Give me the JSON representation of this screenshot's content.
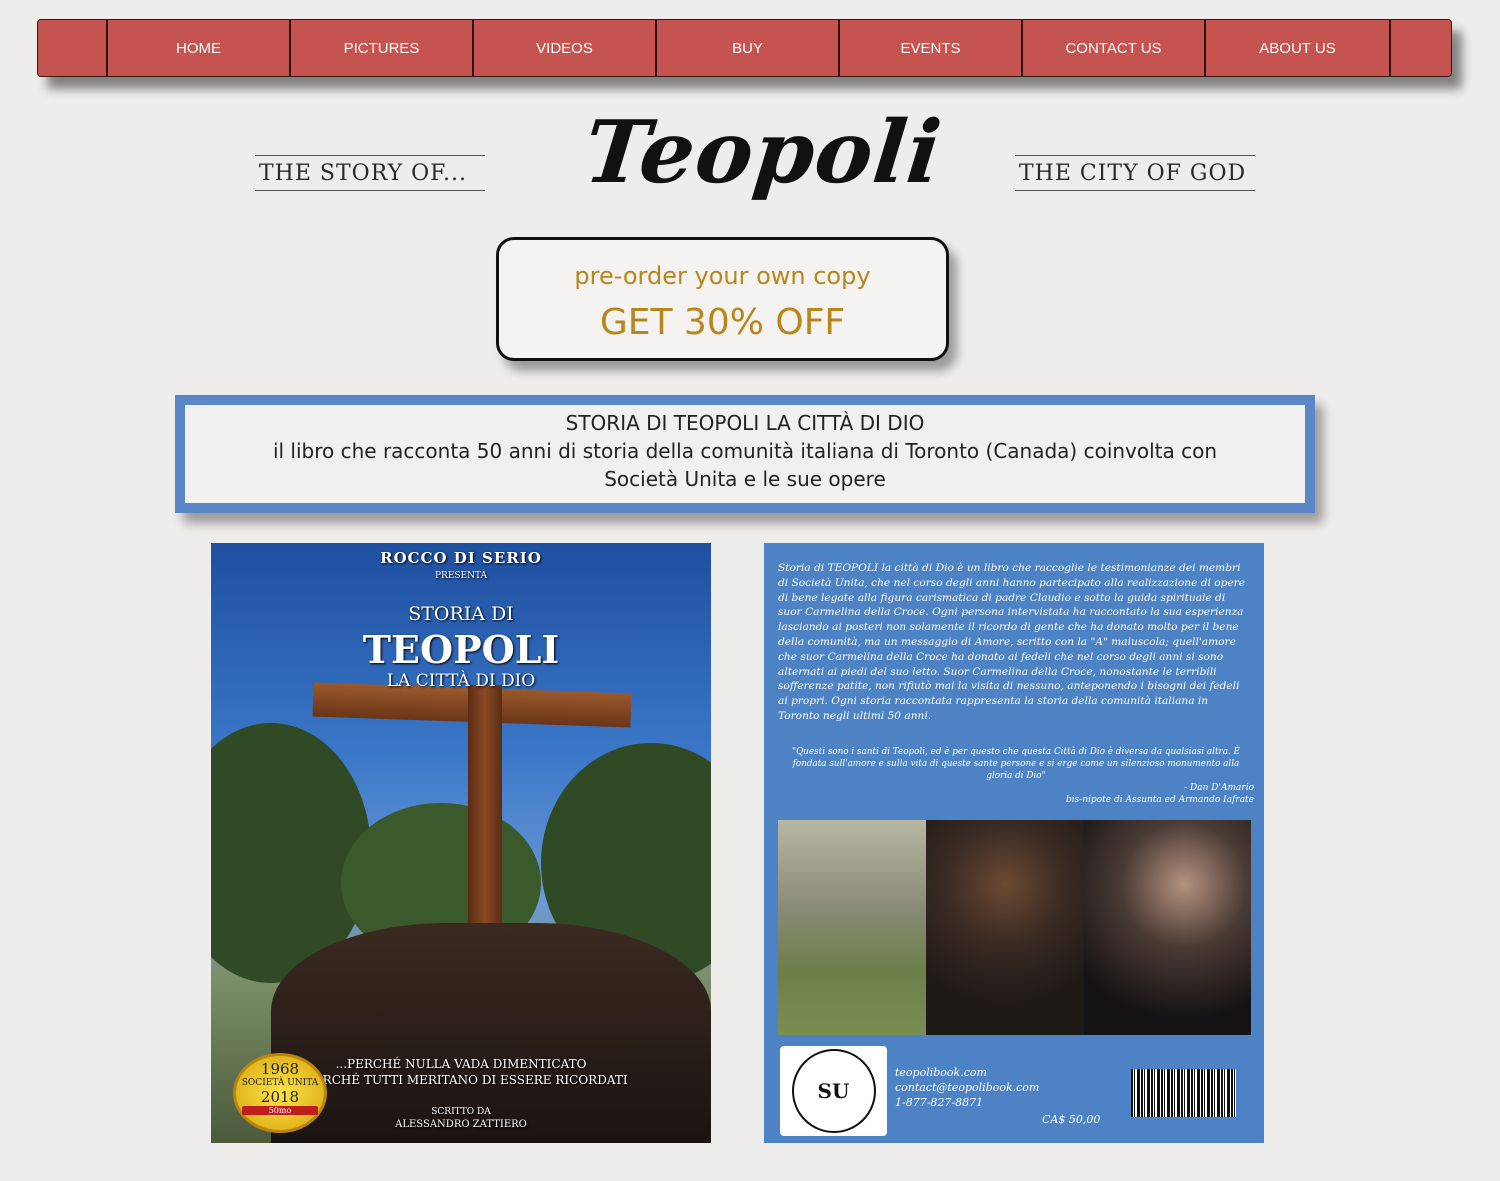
{
  "nav": {
    "items": [
      "HOME",
      "PICTURES",
      "VIDEOS",
      "BUY",
      "EVENTS",
      "CONTACT US",
      "ABOUT US"
    ]
  },
  "header": {
    "left_tagline": "THE STORY OF...",
    "logo_text": "Teopoli",
    "right_tagline": "THE CITY OF GOD"
  },
  "preorder": {
    "line1": "pre-order your own copy",
    "line2": "GET 30% OFF"
  },
  "book_title": {
    "title": "STORIA DI TEOPOLI LA CITTÀ DI DIO",
    "subtitle": "il libro che racconta 50 anni di storia della comunità italiana di Toronto (Canada) coinvolta con Società Unita e le sue opere"
  },
  "front_cover": {
    "author": "ROCCO DI SERIO",
    "presenta": "PRESENTA",
    "storia": "STORIA DI",
    "teopoli": "TEOPOLI",
    "citta": "LA CITTÀ DI DIO",
    "tagline1": "...PERCHÉ NULLA VADA DIMENTICATO",
    "tagline2": "...PERCHÉ TUTTI MERITANO DI ESSERE RICORDATI",
    "scritto_da": "SCRITTO DA",
    "writer": "ALESSANDRO ZATTIERO",
    "seal_year1": "1968",
    "seal_name": "SOCIETÀ UNITA",
    "seal_year2": "2018",
    "seal_anniv": "50mo"
  },
  "back_cover": {
    "description": "Storia di TEOPOLI la città di Dio è un libro che raccoglie le testimonianze dei membri di Società Unita, che nel corso degli anni hanno partecipato alla realizzazione di opere di bene legate alla figura carismatica di padre Claudio e sotto la guida spirituale di suor Carmelina della Croce. Ogni persona intervistata ha raccontato la sua esperienza lasciando ai posteri non solamente il ricordo di gente che ha donato molto per il bene della comunità, ma un messaggio di Amore, scritto con la \"A\" maiuscola; quell'amore che suor Carmelina della Croce ha donato ai fedeli che nel corso degli anni si sono alternati ai piedi del suo letto. Suor Carmelina della Croce, nonostante le terribili sofferenze patite, non rifiutò mai la visita di nessuno, anteponendo i bisogni dei fedeli ai propri. Ogni storia raccontata rappresenta la storia della comunità italiana in Toronto negli ultimi 50 anni.",
    "quote": "\"Questi sono i santi di Teopoli, ed è per questo che questa Città di Dio è diversa da qualsiasi altra. È fondata sull'amore e sulla vita di queste sante persone e si erge come un silenzioso monumento alla gloria di Dio\"",
    "quote_author": "- Dan D'Amario",
    "quote_author_note": "bis-nipote di Assunta ed Armando Iafrate",
    "logo_text": "SU",
    "website": "teopolibook.com",
    "email": "contact@teopolibook.com",
    "phone": "1-877-827-8871",
    "price": "CA$ 50,00"
  }
}
